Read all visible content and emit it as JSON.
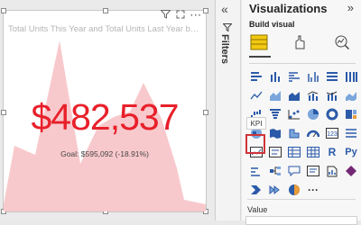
{
  "visual": {
    "title": "Total Units This Year and Total Units Last Year by ...",
    "kpi_value": "$482,537",
    "kpi_goal": "Goal: $595,092 (-18.91%)",
    "header_icons": [
      "filter-icon",
      "focus-mode-icon",
      "more-options-icon"
    ]
  },
  "filters": {
    "collapse_label": "«",
    "label": "Filters"
  },
  "pane": {
    "title": "Visualizations",
    "expand_label": "»",
    "build_label": "Build visual",
    "tooltip": "KPI",
    "value_label": "Value",
    "more_label": "···"
  },
  "colors": {
    "kpi_red": "#e8202a",
    "area_fill": "#f8c9cc",
    "selection_red": "#d13438"
  }
}
